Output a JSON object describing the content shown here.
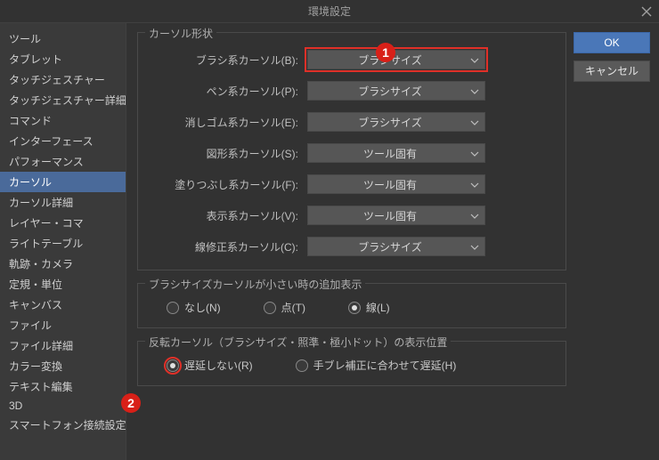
{
  "title": "環境設定",
  "buttons": {
    "ok": "OK",
    "cancel": "キャンセル"
  },
  "sidebar": {
    "items": [
      "ツール",
      "タブレット",
      "タッチジェスチャー",
      "タッチジェスチャー詳細",
      "コマンド",
      "インターフェース",
      "パフォーマンス",
      "カーソル",
      "カーソル詳細",
      "レイヤー・コマ",
      "ライトテーブル",
      "軌跡・カメラ",
      "定規・単位",
      "キャンバス",
      "ファイル",
      "ファイル詳細",
      "カラー変換",
      "テキスト編集",
      "3D",
      "スマートフォン接続設定"
    ],
    "selectedIndex": 7
  },
  "group_shape": {
    "label": "カーソル形状",
    "rows": [
      {
        "label": "ブラシ系カーソル(B):",
        "value": "ブラシサイズ",
        "highlight": true
      },
      {
        "label": "ペン系カーソル(P):",
        "value": "ブラシサイズ"
      },
      {
        "label": "消しゴム系カーソル(E):",
        "value": "ブラシサイズ"
      },
      {
        "label": "図形系カーソル(S):",
        "value": "ツール固有"
      },
      {
        "label": "塗りつぶし系カーソル(F):",
        "value": "ツール固有"
      },
      {
        "label": "表示系カーソル(V):",
        "value": "ツール固有"
      },
      {
        "label": "線修正系カーソル(C):",
        "value": "ブラシサイズ"
      }
    ]
  },
  "group_small": {
    "label": "ブラシサイズカーソルが小さい時の追加表示",
    "options": [
      {
        "label": "なし(N)",
        "selected": false
      },
      {
        "label": "点(T)",
        "selected": false
      },
      {
        "label": "線(L)",
        "selected": true
      }
    ]
  },
  "group_invert": {
    "label": "反転カーソル（ブラシサイズ・照準・極小ドット）の表示位置",
    "options": [
      {
        "label": "遅延しない(R)",
        "selected": true,
        "highlight": true
      },
      {
        "label": "手ブレ補正に合わせて遅延(H)",
        "selected": false
      }
    ]
  },
  "badges": {
    "one": "1",
    "two": "2"
  }
}
